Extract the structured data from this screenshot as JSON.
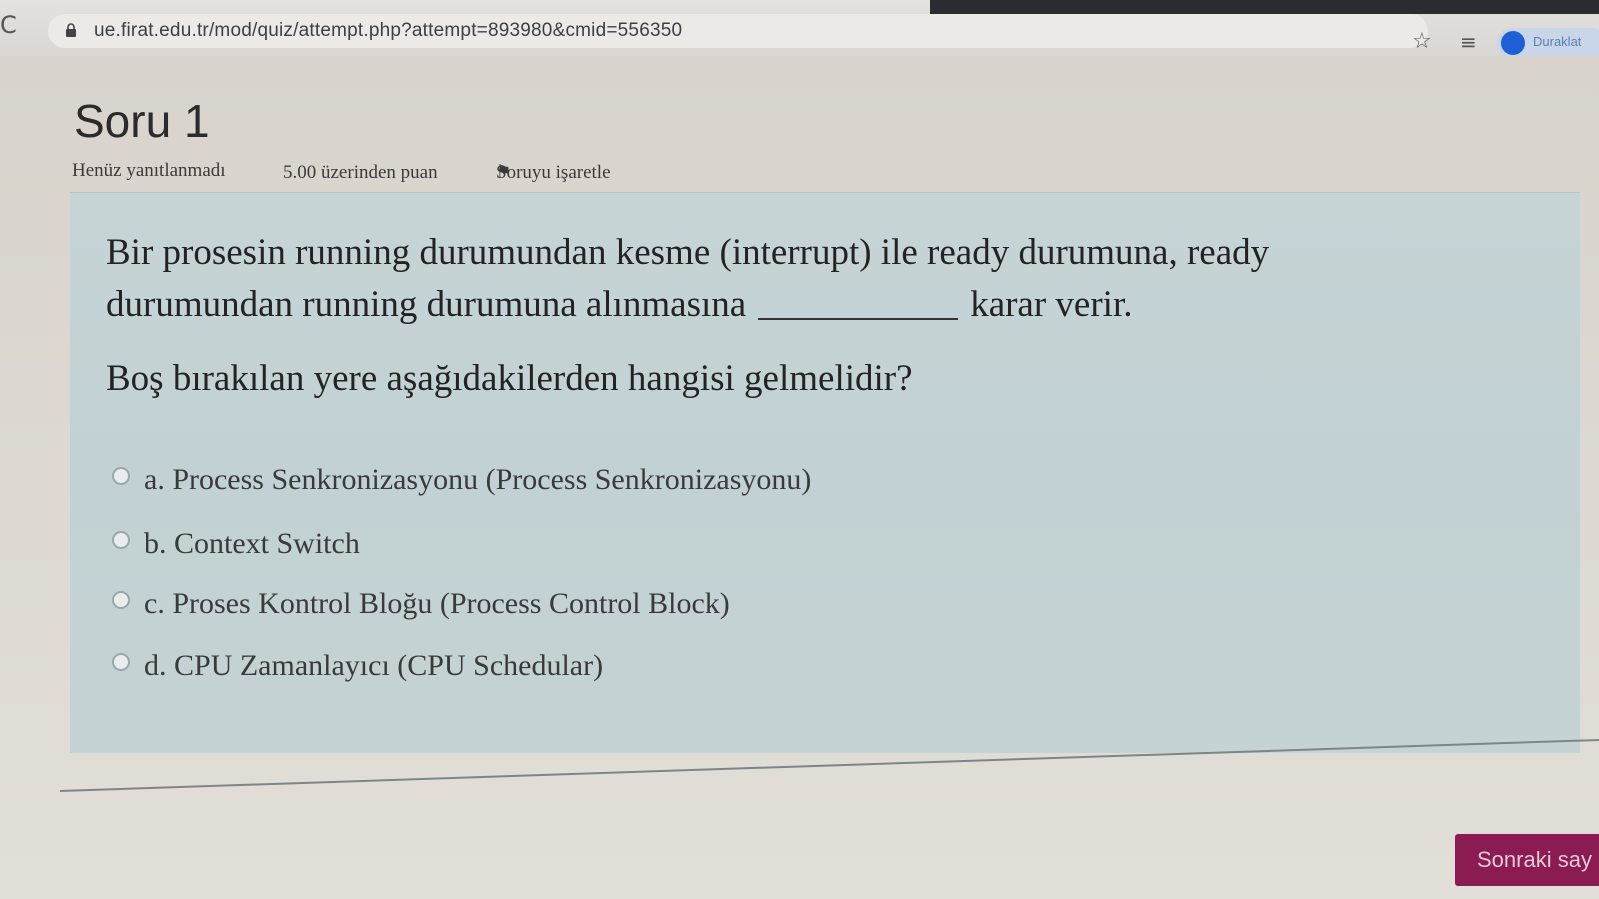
{
  "browser": {
    "reload_glyph": "C",
    "url": "ue.firat.edu.tr/mod/quiz/attempt.php?attempt=893980&cmid=556350",
    "star_glyph": "☆",
    "reading_list_glyph": "≡",
    "profile_label": "Duraklat"
  },
  "question": {
    "title": "Soru 1",
    "status": "Henüz yanıtlanmadı",
    "points": "5.00 üzerinden puan",
    "flag_glyph": "⚑",
    "flag_label": "Soruyu işaretle",
    "text_line1": "Bir prosesin running durumundan kesme (interrupt) ile ready durumuna, ready",
    "text_line2_start": "durumundan running durumuna alınmasına",
    "text_line2_end": "karar verir.",
    "prompt": "Boş bırakılan yere aşağıdakilerden hangisi gelmelidir?",
    "options": [
      {
        "label": "a. Process Senkronizasyonu (Process Senkronizasyonu)"
      },
      {
        "label": "b. Context Switch"
      },
      {
        "label": "c. Proses Kontrol Bloğu (Process Control Block)"
      },
      {
        "label": "d. CPU Zamanlayıcı (CPU Schedular)"
      }
    ]
  },
  "navigation": {
    "next_label": "Sonraki say"
  },
  "colors": {
    "next_button": "#8a1b53",
    "question_bg": "#c4d2d4",
    "page_bg": "#dcd8d1"
  }
}
